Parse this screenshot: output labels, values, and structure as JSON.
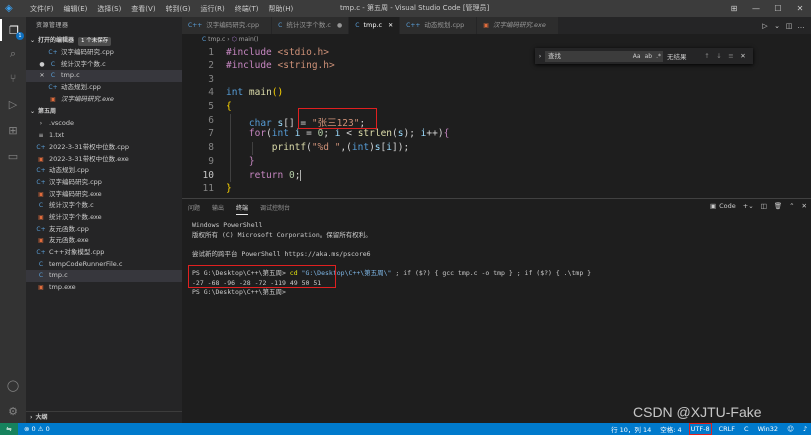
{
  "titlebar": {
    "menu": [
      "文件(F)",
      "编辑(E)",
      "选择(S)",
      "查看(V)",
      "转到(G)",
      "运行(R)",
      "终端(T)",
      "帮助(H)"
    ],
    "window_title": "tmp.c - 第五周 - Visual Studio Code [管理员]",
    "controls": [
      "layout-icon",
      "minimize-icon",
      "maximize-icon",
      "close-icon"
    ]
  },
  "activity": {
    "items": [
      "explorer-icon",
      "search-icon",
      "source-control-icon",
      "run-debug-icon",
      "extensions-icon",
      "remote-explorer-icon"
    ],
    "badge": "1",
    "bottom": [
      "account-icon",
      "settings-icon"
    ]
  },
  "sidebar": {
    "title": "资源管理器",
    "open_editors": {
      "label": "打开的编辑器",
      "badge": "1 个未保存",
      "items": [
        {
          "name": "汉字编码研究.cpp",
          "type": "cpp",
          "marker": ""
        },
        {
          "name": "统计汉字个数.c",
          "type": "c",
          "marker": "●"
        },
        {
          "name": "tmp.c",
          "type": "c",
          "marker": "✕"
        },
        {
          "name": "动态规划.cpp",
          "type": "cpp",
          "marker": ""
        },
        {
          "name": "汉字编码研究.exe",
          "type": "exe",
          "marker": ""
        }
      ]
    },
    "folder": {
      "label": "第五周",
      "items": [
        {
          "name": ".vscode",
          "type": "folder"
        },
        {
          "name": "1.txt",
          "type": "txt"
        },
        {
          "name": "2022-3-31带权中位数.cpp",
          "type": "cpp"
        },
        {
          "name": "2022-3-31带权中位数.exe",
          "type": "exe"
        },
        {
          "name": "动态规划.cpp",
          "type": "cpp"
        },
        {
          "name": "汉字编码研究.cpp",
          "type": "cpp"
        },
        {
          "name": "汉字编码研究.exe",
          "type": "exe"
        },
        {
          "name": "统计汉字个数.c",
          "type": "c"
        },
        {
          "name": "统计汉字个数.exe",
          "type": "exe"
        },
        {
          "name": "友元函数.cpp",
          "type": "cpp"
        },
        {
          "name": "友元函数.exe",
          "type": "exe"
        },
        {
          "name": "C++对象模型.cpp",
          "type": "cpp"
        },
        {
          "name": "tempCodeRunnerFile.c",
          "type": "c"
        },
        {
          "name": "tmp.c",
          "type": "c"
        },
        {
          "name": "tmp.exe",
          "type": "exe"
        }
      ]
    },
    "outline_label": "大纲"
  },
  "tabs": [
    {
      "label": "汉字编码研究.cpp",
      "icon": "C++",
      "close": "",
      "active": false,
      "italic": false
    },
    {
      "label": "统计汉字个数.c",
      "icon": "C",
      "close": "●",
      "active": false,
      "italic": false
    },
    {
      "label": "tmp.c",
      "icon": "C",
      "close": "✕",
      "active": true,
      "italic": false
    },
    {
      "label": "动态规划.cpp",
      "icon": "C++",
      "close": "",
      "active": false,
      "italic": false
    },
    {
      "label": "汉字编码研究.exe",
      "icon": "▣",
      "close": "",
      "active": false,
      "italic": true
    }
  ],
  "breadcrumb": {
    "file": "tmp.c",
    "symbol": "main()"
  },
  "editor": {
    "line_numbers": [
      "1",
      "2",
      "3",
      "4",
      "5",
      "6",
      "7",
      "8",
      "9",
      "10",
      "11"
    ],
    "current_line": "10"
  },
  "find": {
    "placeholder": "查找",
    "options": [
      "Aa",
      "ab",
      ".*"
    ],
    "result": "无结果"
  },
  "panel": {
    "tabs": [
      "问题",
      "输出",
      "终端",
      "调试控制台"
    ],
    "active_tab": "终端",
    "shell": "Code",
    "terminal_lines": [
      "Windows PowerShell",
      "版权所有 (C) Microsoft Corporation。保留所有权利。",
      "",
      "尝试新的跨平台 PowerShell https://aka.ms/pscore6",
      ""
    ],
    "prompt1": "PS G:\\Desktop\\C++\\第五周> ",
    "cmd1_a": "cd ",
    "cmd1_b": "\"G:\\Desktop\\C++\\第五周\\\"",
    "cmd1_c": " ; if ($?) { gcc tmp.c -o tmp } ; if ($?) { .\\tmp }",
    "output": "-27 -68 -96 -28 -72 -119 49 50 51",
    "prompt2": "PS G:\\Desktop\\C++\\第五周>"
  },
  "status": {
    "remote": "⇋",
    "problems": "⊗ 0 ⚠ 0",
    "position": "行 10，列 14",
    "spaces": "空格: 4",
    "encoding": "UTF-8",
    "eol": "CRLF",
    "language": "C",
    "platform": "Win32"
  },
  "watermark": "CSDN @XJTU-Fake"
}
